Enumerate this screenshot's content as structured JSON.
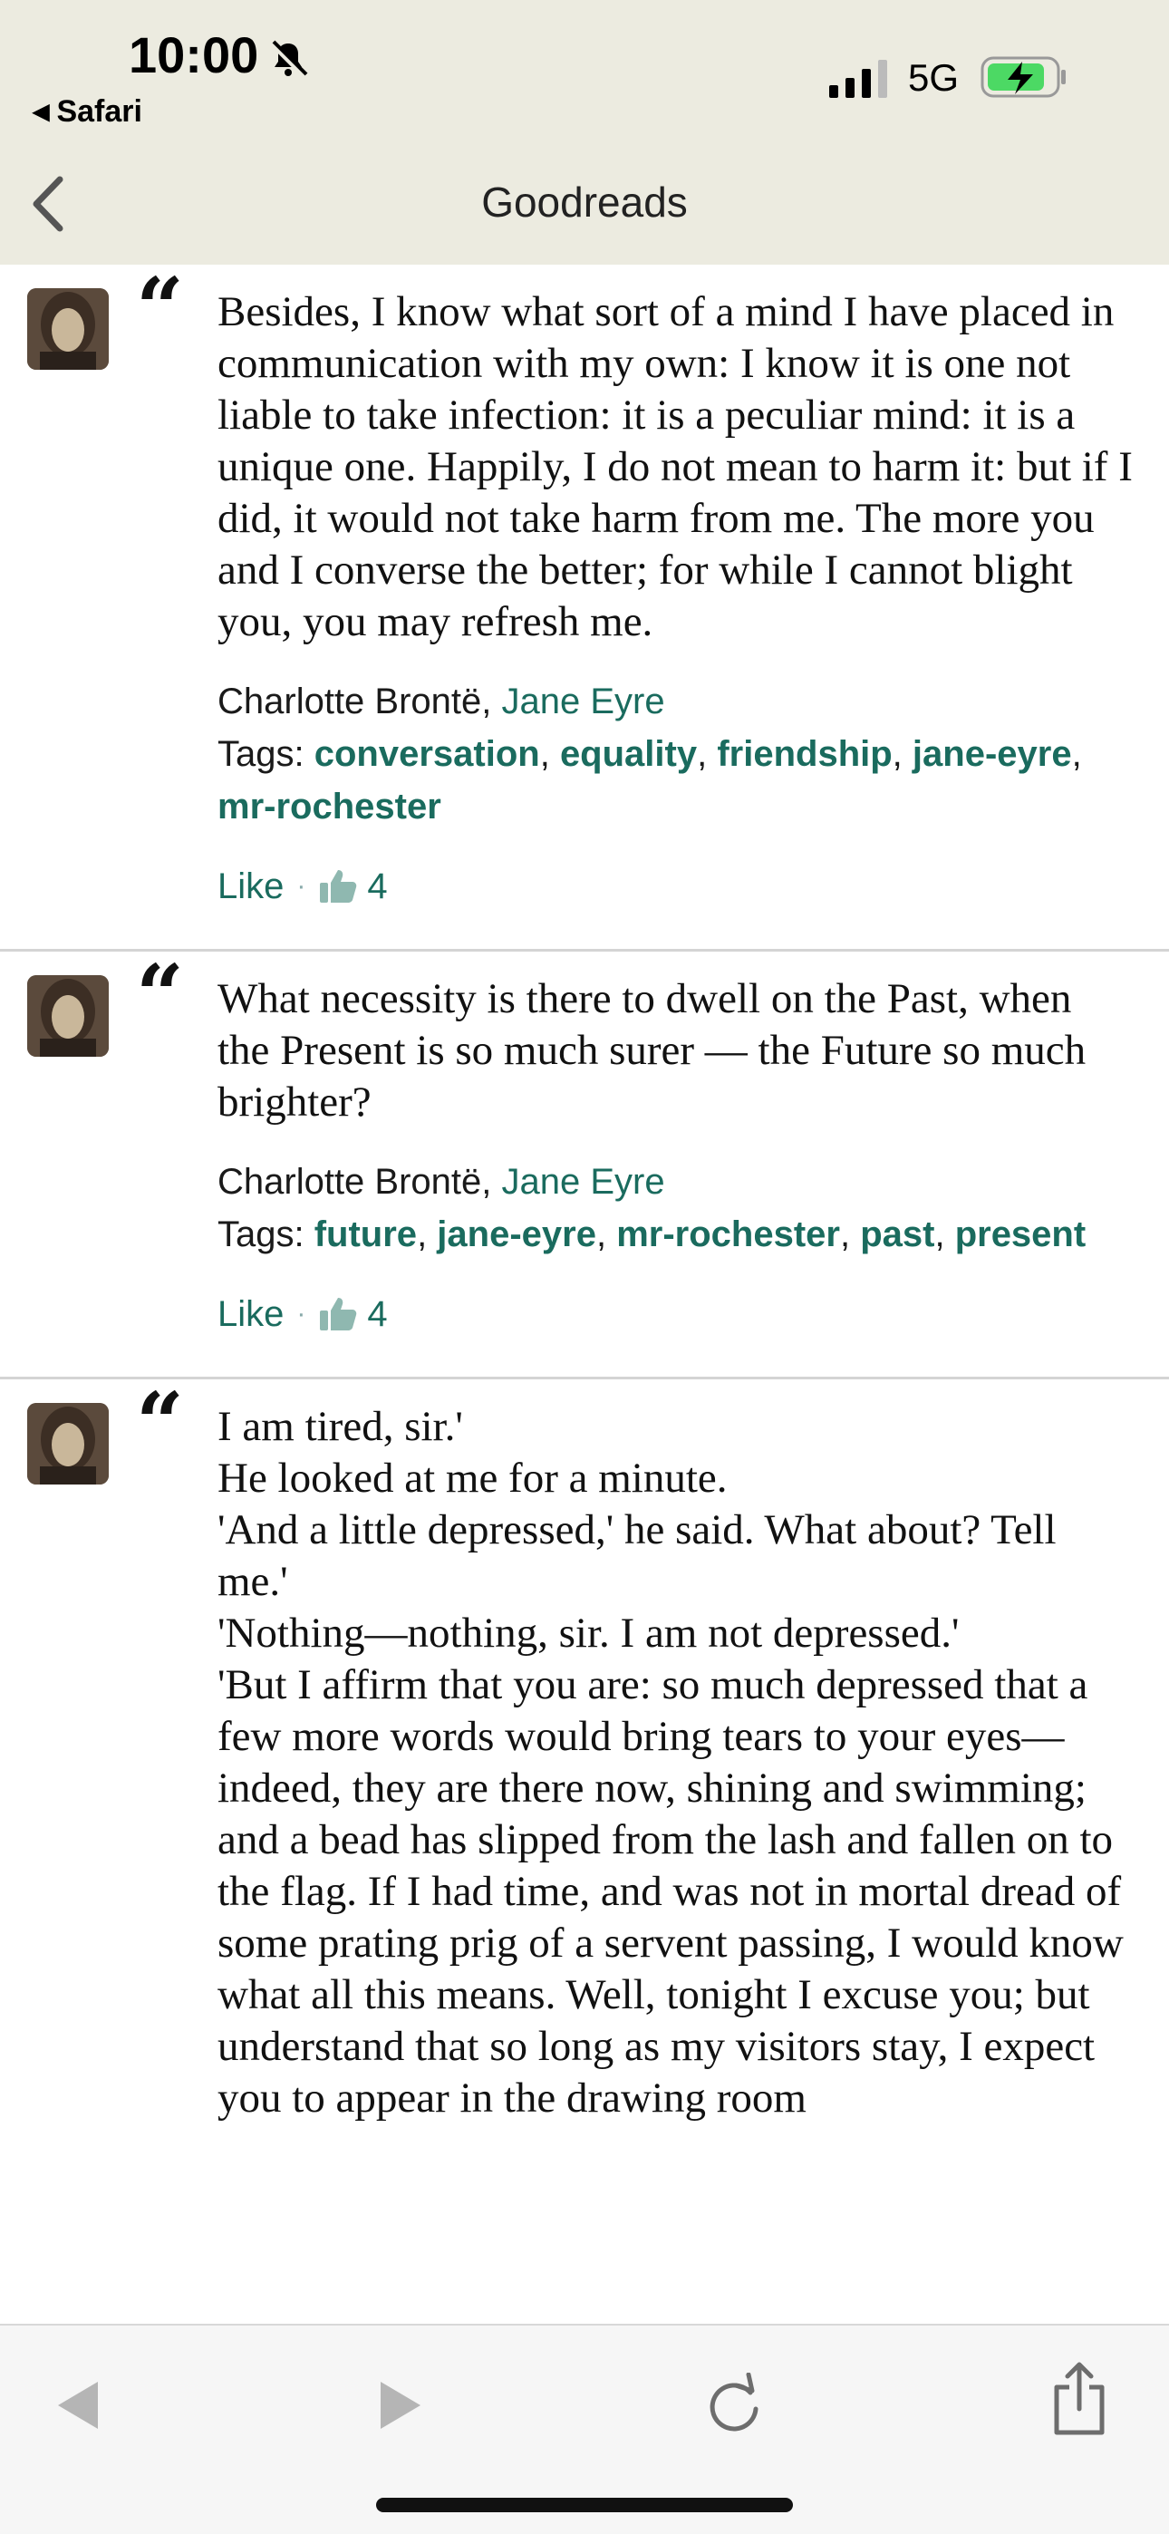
{
  "status_bar": {
    "time": "10:00",
    "back_app": "Safari",
    "network": "5G"
  },
  "nav": {
    "title": "Goodreads"
  },
  "quotes": [
    {
      "text": "Besides, I know what sort of a mind I have placed in communication with my own: I know it is one not liable to take infection: it is a peculiar mind: it is a unique one. Happily, I do not mean to harm it: but if I did, it would not take harm from me. The more you and I converse the better; for while I cannot blight you, you may refresh me.",
      "author": "Charlotte Brontë",
      "book": "Jane Eyre",
      "tags_label": "Tags:",
      "tags": [
        "conversation",
        "equality",
        "friendship",
        "jane-eyre",
        "mr-rochester"
      ],
      "like_label": "Like",
      "like_count": "4"
    },
    {
      "text": "What necessity is there to dwell on the Past, when the Present is so much surer — the Future so much brighter?",
      "author": "Charlotte Brontë",
      "book": "Jane Eyre",
      "tags_label": "Tags:",
      "tags": [
        "future",
        "jane-eyre",
        "mr-rochester",
        "past",
        "present"
      ],
      "like_label": "Like",
      "like_count": "4"
    },
    {
      "text": "I am tired, sir.'\nHe looked at me for a minute.\n'And a little depressed,' he said. What about? Tell me.'\n'Nothing—nothing, sir. I am not depressed.'\n'But I affirm that you are: so much depressed that a few more words would bring tears to your eyes—indeed, they are there now, shining and swimming; and a bead has slipped from the lash and fallen on to the flag. If I had time, and was not in mortal dread of some prating prig of a servent passing, I would know what all this means. Well, tonight I excuse you; but understand that so long as my visitors stay, I expect you to appear in the drawing room"
    }
  ],
  "toolbar": {
    "buttons": [
      "back-arrow-icon",
      "forward-arrow-icon",
      "reload-icon",
      "share-icon"
    ]
  }
}
